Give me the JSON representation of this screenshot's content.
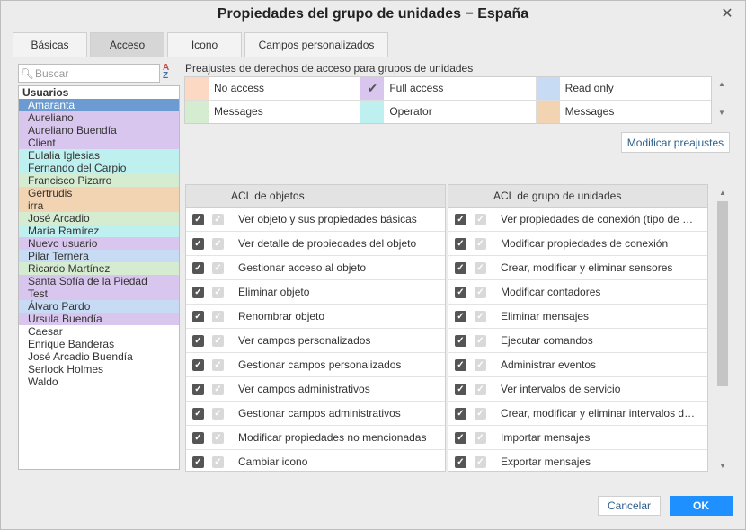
{
  "window": {
    "title": "Propiedades del grupo de unidades − España"
  },
  "tabs": [
    {
      "label": "Básicas",
      "active": false
    },
    {
      "label": "Acceso",
      "active": true
    },
    {
      "label": "Icono",
      "active": false
    },
    {
      "label": "Campos personalizados",
      "active": false
    }
  ],
  "search": {
    "placeholder": "Buscar"
  },
  "users": {
    "header": "Usuarios",
    "items": [
      {
        "name": "Amaranta",
        "color": "#6b9bd1",
        "selected": true
      },
      {
        "name": "Aureliano",
        "color": "#d9c6ee"
      },
      {
        "name": "Aureliano Buendía",
        "color": "#d9c6ee"
      },
      {
        "name": "Client",
        "color": "#d9c6ee"
      },
      {
        "name": "Eulalia Iglesias",
        "color": "#bff0f0"
      },
      {
        "name": "Fernando del Carpio",
        "color": "#bff0f0"
      },
      {
        "name": "Francisco Pizarro",
        "color": "#d5ecd0"
      },
      {
        "name": "Gertrudis",
        "color": "#f2d3b2"
      },
      {
        "name": "irra",
        "color": "#f2d3b2"
      },
      {
        "name": "José Arcadio",
        "color": "#d5ecd0"
      },
      {
        "name": "María Ramírez",
        "color": "#bff0f0"
      },
      {
        "name": "Nuevo usuario",
        "color": "#d9c6ee"
      },
      {
        "name": "Pilar Ternera",
        "color": "#c7dbf5"
      },
      {
        "name": "Ricardo Martínez",
        "color": "#d5ecd0"
      },
      {
        "name": "Santa Sofía de la Piedad",
        "color": "#d9c6ee"
      },
      {
        "name": "Test",
        "color": "#d9c6ee"
      },
      {
        "name": "Álvaro Pardo",
        "color": "#c7dbf5"
      },
      {
        "name": "Ursula Buendía",
        "color": "#d9c6ee"
      },
      {
        "name": "Caesar",
        "color": "#ffffff"
      },
      {
        "name": "Enrique Banderas",
        "color": "#ffffff"
      },
      {
        "name": "José Arcadio Buendía",
        "color": "#ffffff"
      },
      {
        "name": "Serlock Holmes",
        "color": "#ffffff"
      },
      {
        "name": "Waldo",
        "color": "#ffffff"
      }
    ]
  },
  "presets": {
    "label": "Preajustes de derechos de acceso para grupos de unidades",
    "rows": [
      [
        {
          "name": "No access",
          "color": "#fcd9c3",
          "check": ""
        },
        {
          "name": "Full access",
          "color": "#d9c6ee",
          "check": "✔"
        },
        {
          "name": "Read only",
          "color": "#c7dbf5",
          "check": ""
        }
      ],
      [
        {
          "name": "Messages",
          "color": "#d5ecd0",
          "check": ""
        },
        {
          "name": "Operator",
          "color": "#bff0f0",
          "check": ""
        },
        {
          "name": "Messages",
          "color": "#f2d3b2",
          "check": ""
        }
      ]
    ],
    "modify_button": "Modificar preajustes"
  },
  "acl_objects": {
    "header": "ACL de objetos",
    "rows": [
      "Ver objeto y sus propiedades básicas",
      "Ver detalle de propiedades del objeto",
      "Gestionar acceso al objeto",
      "Eliminar objeto",
      "Renombrar objeto",
      "Ver campos personalizados",
      "Gestionar campos personalizados",
      "Ver campos administrativos",
      "Gestionar campos administrativos",
      "Modificar propiedades no mencionadas",
      "Cambiar icono"
    ]
  },
  "acl_units": {
    "header": "ACL de grupo de unidades",
    "rows": [
      "Ver propiedades de conexión (tipo de …",
      "Modificar propiedades de conexión",
      "Crear, modificar y eliminar sensores",
      "Modificar contadores",
      "Eliminar mensajes",
      "Ejecutar comandos",
      "Administrar eventos",
      "Ver intervalos de servicio",
      "Crear, modificar y eliminar intervalos d…",
      "Importar mensajes",
      "Exportar mensajes"
    ]
  },
  "footer": {
    "cancel_label": "Cancelar",
    "ok_label": "OK"
  },
  "colors": {
    "ok_button": "#1e90ff",
    "selection": "#6b9bd1"
  }
}
